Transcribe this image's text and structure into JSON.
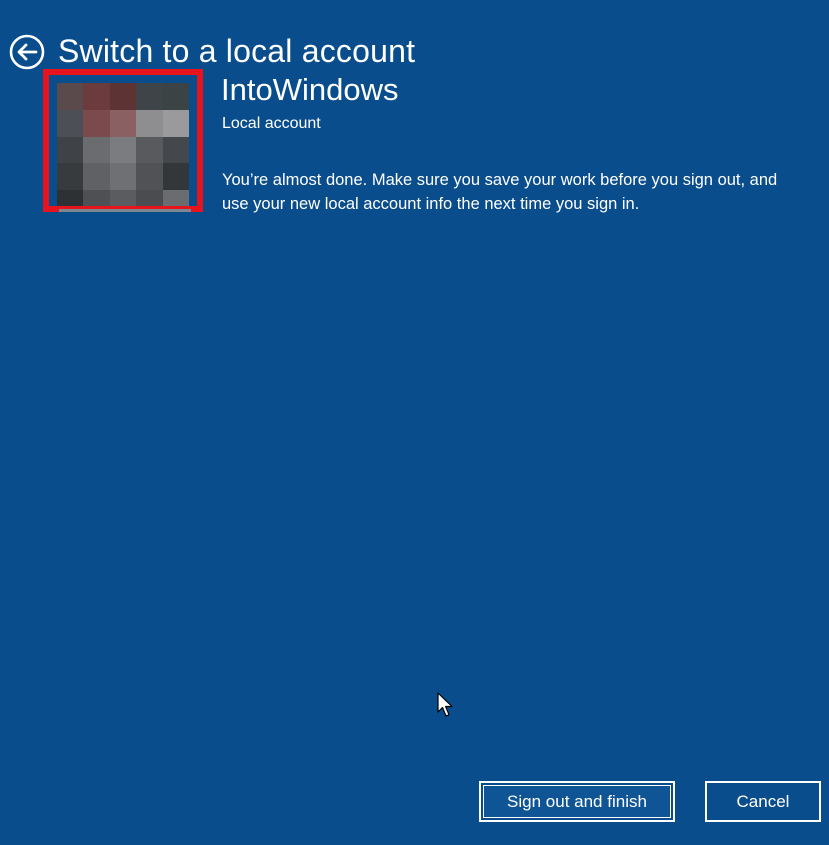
{
  "header": {
    "title": "Switch to a local account",
    "back_icon": "back-arrow-circle-icon"
  },
  "account": {
    "name": "IntoWindows",
    "type": "Local account",
    "avatar_note": "pixelated profile picture",
    "message": "You’re almost done. Make sure you save your work before you sign out, and use your new local account info the next time you sign in."
  },
  "buttons": {
    "primary_label": "Sign out and finish",
    "secondary_label": "Cancel"
  },
  "colors": {
    "background": "#0a4d8c",
    "highlight_border": "#e8141d",
    "text": "#ffffff"
  },
  "avatar_pixels": [
    "#5a4a4c",
    "#6b3b3d",
    "#5e3334",
    "#3e4447",
    "#3b4345",
    "#4c4f55",
    "#7a4a4c",
    "#8b6062",
    "#8e8e90",
    "#9a9a9c",
    "#3f4246",
    "#6a6c70",
    "#7a7c80",
    "#585a5e",
    "#44474b",
    "#383b3e",
    "#5f6165",
    "#6e7074",
    "#505256",
    "#34373a",
    "#2e3134",
    "#4e5054",
    "#5a5c60",
    "#4a4c50",
    "#6a6c70"
  ]
}
